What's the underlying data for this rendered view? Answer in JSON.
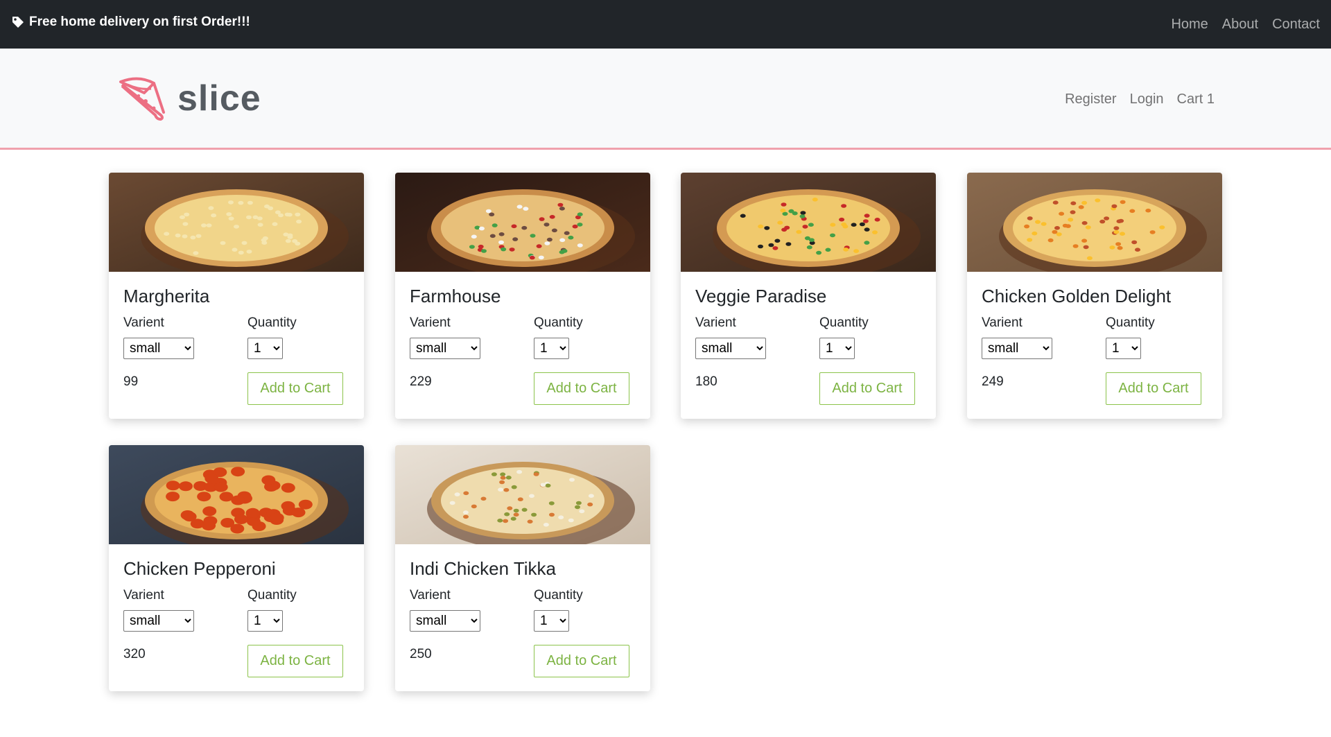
{
  "topbar": {
    "promo_text": "Free home delivery on first Order!!!",
    "promo_icon": "tag-icon",
    "nav": [
      "Home",
      "About",
      "Contact"
    ]
  },
  "header": {
    "brand_name": "slice",
    "logo_icon": "pizza-slice-icon",
    "nav": [
      "Register",
      "Login",
      "Cart 1"
    ],
    "accent_color": "#f0a1ac"
  },
  "labels": {
    "variant": "Varient",
    "quantity": "Quantity",
    "add_to_cart": "Add to Cart"
  },
  "products": [
    {
      "name": "Margherita",
      "variant": "small",
      "quantity": "1",
      "price": "99"
    },
    {
      "name": "Farmhouse",
      "variant": "small",
      "quantity": "1",
      "price": "229"
    },
    {
      "name": "Veggie Paradise",
      "variant": "small",
      "quantity": "1",
      "price": "180"
    },
    {
      "name": "Chicken Golden Delight",
      "variant": "small",
      "quantity": "1",
      "price": "249"
    },
    {
      "name": "Chicken Pepperoni",
      "variant": "small",
      "quantity": "1",
      "price": "320"
    },
    {
      "name": "Indi Chicken Tikka",
      "variant": "small",
      "quantity": "1",
      "price": "250"
    }
  ]
}
